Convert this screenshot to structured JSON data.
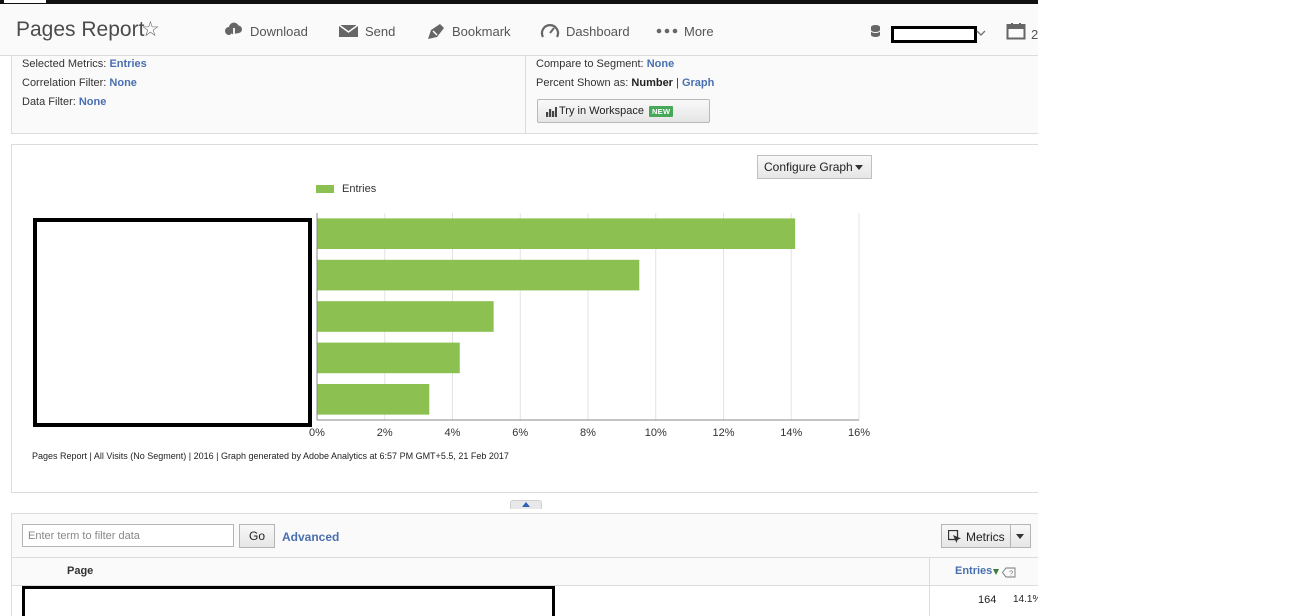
{
  "header": {
    "title": "Pages Report",
    "toolbar": [
      {
        "label": "Download",
        "icon": "cloud-download-icon"
      },
      {
        "label": "Send",
        "icon": "envelope-icon"
      },
      {
        "label": "Bookmark",
        "icon": "bookmark-icon"
      },
      {
        "label": "Dashboard",
        "icon": "gauge-icon"
      },
      {
        "label": "More",
        "icon": "more-dots-icon"
      }
    ],
    "date_partial": "2"
  },
  "settings": {
    "selected_metrics": {
      "label": "Selected Metrics:",
      "value": "Entries"
    },
    "correlation_filter": {
      "label": "Correlation Filter:",
      "value": "None"
    },
    "data_filter": {
      "label": "Data Filter:",
      "value": "None"
    },
    "compare_segment": {
      "label": "Compare to Segment:",
      "value": "None"
    },
    "percent_shown": {
      "label": "Percent Shown as:",
      "number": "Number",
      "separator": "|",
      "graph": "Graph"
    },
    "workspace_button": {
      "label": "Try in Workspace",
      "badge": "NEW"
    }
  },
  "graph": {
    "configure_label": "Configure Graph",
    "legend_label": "Entries",
    "footnote": "Pages Report | All Visits (No Segment) | 2016 | Graph generated by Adobe Analytics at  6:57 PM GMT+5.5, 21 Feb 2017"
  },
  "chart_data": {
    "type": "bar",
    "orientation": "horizontal",
    "series": [
      {
        "name": "Entries",
        "values": [
          14.1,
          9.5,
          5.2,
          4.2,
          3.3
        ]
      }
    ],
    "xlim": [
      0,
      16
    ],
    "x_ticks": [
      "0%",
      "2%",
      "4%",
      "6%",
      "8%",
      "10%",
      "12%",
      "14%",
      "16%"
    ],
    "grid": true,
    "legend_position": "top-left",
    "color": "#8cc152"
  },
  "table": {
    "filter_placeholder": "Enter term to filter data",
    "go_label": "Go",
    "advanced_label": "Advanced",
    "metrics_label": "Metrics",
    "columns": {
      "page": "Page",
      "entries": "Entries"
    },
    "rows": [
      {
        "entries": "164",
        "percent": "14.1%"
      }
    ]
  }
}
